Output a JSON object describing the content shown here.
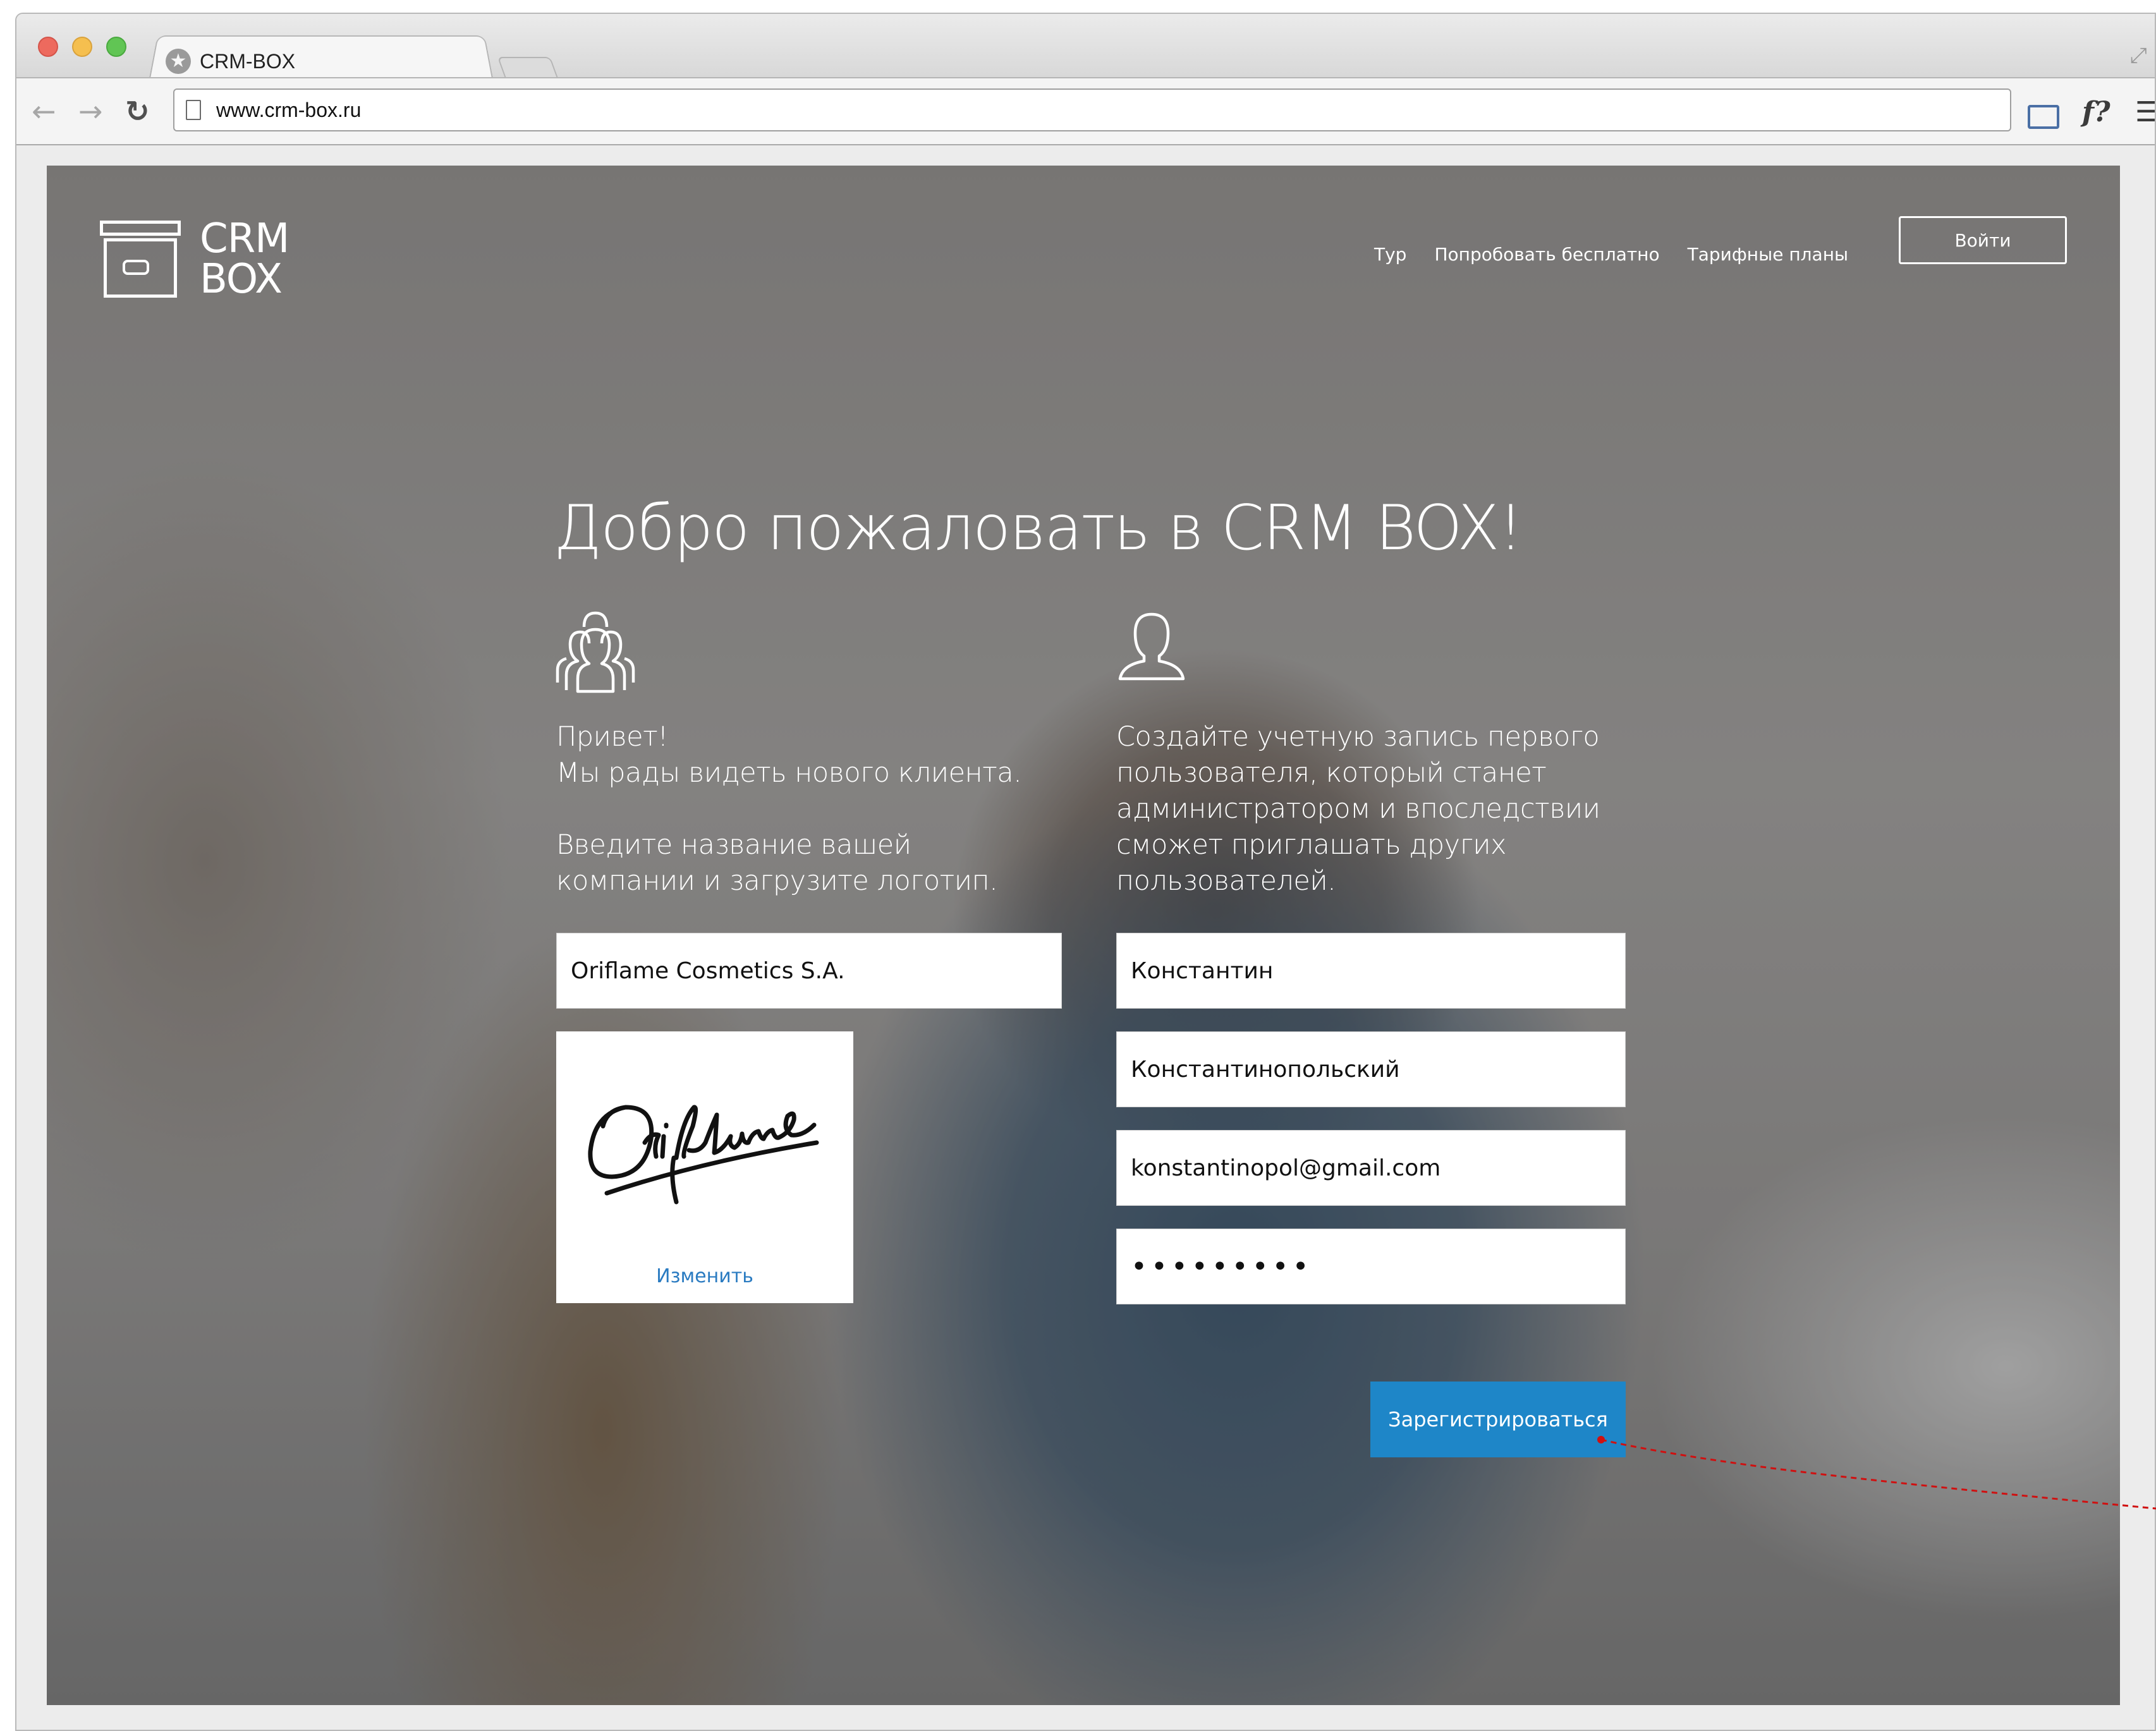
{
  "browser": {
    "tab_title": "CRM-BOX",
    "url": "www.crm-box.ru",
    "icons": [
      "close-window-icon",
      "minimize-window-icon",
      "maximize-window-icon",
      "back-icon",
      "forward-icon",
      "reload-icon",
      "page-icon",
      "cast-icon",
      "font-icon",
      "menu-icon"
    ],
    "font_button": "f?"
  },
  "header": {
    "logo_text_line1": "CRM",
    "logo_text_line2": "BOX",
    "nav": [
      "Тур",
      "Попробовать бесплатно",
      "Тарифные планы"
    ],
    "login_label": "Войти"
  },
  "hero": {
    "title": "Добро пожаловать в CRM BOX!"
  },
  "company_column": {
    "icon": "team-icon",
    "greeting_line1": "Привет!",
    "greeting_line2": "Мы рады видеть нового клиента.",
    "instruction_line1": "Введите название вашей",
    "instruction_line2": "компании и загрузите логотип.",
    "company_name_value": "Oriflame Cosmetics S.A.",
    "uploaded_logo": "Oriflame",
    "change_logo_label": "Изменить"
  },
  "user_column": {
    "icon": "user-icon",
    "description_lines": [
      "Создайте учетную запись первого",
      "пользователя, который станет",
      "администратором и впоследствии",
      "сможет приглашать других",
      "пользователей."
    ],
    "first_name_value": "Константин",
    "last_name_value": "Константинопольский",
    "email_value": "konstantinopol@gmail.com",
    "password_mask": "•••••••••"
  },
  "actions": {
    "register_label": "Зарегистрироваться"
  },
  "colors": {
    "primary_button": "#1e86c8",
    "link": "#2a7bc1",
    "annotation_line": "#d01010"
  }
}
